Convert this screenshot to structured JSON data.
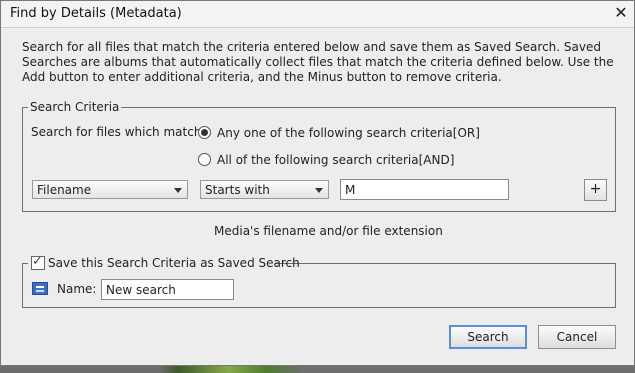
{
  "dialog": {
    "title": "Find by Details (Metadata)",
    "intro": "Search for all files that match the criteria entered below and save them as Saved Search. Saved Searches are albums that automatically collect files that match the criteria defined below. Use the Add button to enter additional criteria, and the Minus button to remove criteria."
  },
  "criteria": {
    "legend": "Search Criteria",
    "match_label": "Search for files which match:",
    "option_any": "Any one of the following search criteria[OR]",
    "option_all": "All of the following search criteria[AND]",
    "selected": "any",
    "field_value": "Filename",
    "operator_value": "Starts with",
    "text_value": "M",
    "add_label": "+",
    "hint": "Media's filename and/or file extension"
  },
  "save": {
    "checkbox_label": "Save this Search Criteria as Saved Search",
    "checked": true,
    "name_label": "Name:",
    "name_value": "New search"
  },
  "buttons": {
    "search": "Search",
    "cancel": "Cancel"
  },
  "icons": {
    "close": "close-icon",
    "saved_search": "saved-search-icon",
    "dropdown": "chevron-down-icon"
  }
}
